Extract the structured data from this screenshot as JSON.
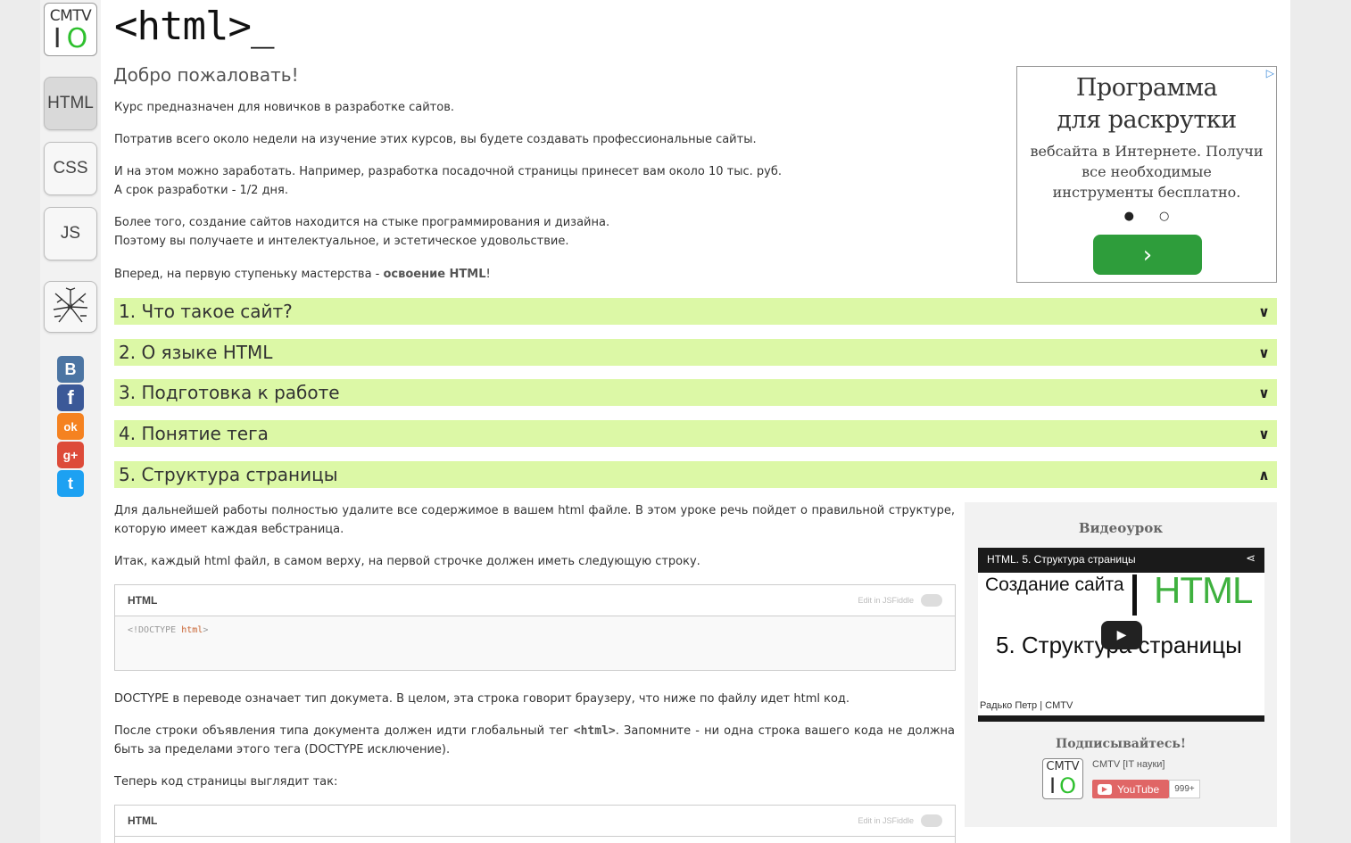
{
  "sidebar": {
    "logo": {
      "line1": "CMTV",
      "line2_bar": "I",
      "line2_o": "O"
    },
    "nav": [
      {
        "label": "HTML",
        "active": true
      },
      {
        "label": "CSS",
        "active": false
      },
      {
        "label": "JS",
        "active": false
      }
    ],
    "tree_icon": "network-tree-icon",
    "social": [
      {
        "name": "vk",
        "glyph": "B",
        "color": "#4c75a3"
      },
      {
        "name": "facebook",
        "glyph": "f",
        "color": "#3b5998"
      },
      {
        "name": "odnoklassniki",
        "glyph": "ok",
        "color": "#f58220"
      },
      {
        "name": "google-plus",
        "glyph": "g+",
        "color": "#dd4b39"
      },
      {
        "name": "twitter",
        "glyph": "t",
        "color": "#1da1f2"
      }
    ]
  },
  "header": {
    "title": "<html>_"
  },
  "welcome": {
    "title": "Добро пожаловать!",
    "p1": "Курс предназначен для новичков в разработке сайтов.",
    "p2": "Потратив всего около недели на изучение этих курсов, вы будете создавать профессиональные сайты.",
    "p3a": "И на этом можно заработать. Например, разработка посадочной страницы принесет вам около 10 тыс. руб.",
    "p3b": "А срок разработки - 1/2 дня.",
    "p4a": "Более того, создание сайтов находится на стыке программирования и дизайна.",
    "p4b": "Поэтому вы получаете и интелектуальное, и эстетическое удовольствие.",
    "p5_text": "Вперед, на первую ступеньку мастерства - ",
    "p5_bold": "освоение HTML",
    "p5_end": "!"
  },
  "ad": {
    "title": "Программа для раскрутки",
    "text": "вебсайта в Интернете. Получи все необходимые инструменты бесплатно.",
    "dots": "● ○",
    "button": "›",
    "corner": "▷"
  },
  "accordion": [
    {
      "label": "1. Что такое сайт?",
      "chevron": "∨"
    },
    {
      "label": "2. О языке HTML",
      "chevron": "∨"
    },
    {
      "label": "3. Подготовка к работе",
      "chevron": "∨"
    },
    {
      "label": "4. Понятие тега",
      "chevron": "∨"
    },
    {
      "label": "5. Структура страницы",
      "chevron": "∧"
    }
  ],
  "lesson": {
    "p1": "Для дальнейшей работы полностью удалите все содержимое в вашем html файле. В этом уроке речь пойдет о правильной структуре, которую имеет каждая вебстраница.",
    "p2": "Итак, каждый html файл, в самом верху, на первой строчке должен иметь следующую строку.",
    "code1": {
      "lang": "HTML",
      "edit": "Edit in JSFiddle",
      "line_a": "<!DOCTYPE ",
      "line_b": "html",
      "line_c": ">"
    },
    "p3": "DOCTYPE в переводе означает тип докумета. В целом, эта строка говорит браузеру, что ниже по файлу идет html код.",
    "p4a": "После строки объявления типа документа должен идти глобальный тег ",
    "p4_tag": "<html>",
    "p4b": ". Запомните - ни одна строка вашего кода не должна быть за пределами этого тега (DOCTYPE исключение).",
    "p5": "Теперь код страницы выглядит так:",
    "code2": {
      "lang": "HTML",
      "edit": "Edit in JSFiddle"
    }
  },
  "video": {
    "panel_title": "Видеоурок",
    "top_title": "HTML. 5. Структура страницы",
    "share": "⋖",
    "line_a": "Создание сайта",
    "line_b": "HTML",
    "line_c": "5. Структура страницы",
    "play": "▶",
    "author": "Радько Петр | CMTV"
  },
  "subscribe": {
    "title": "Подписывайтесь!",
    "logo": {
      "line1": "CMTV",
      "line2_bar": "I",
      "line2_o": "O"
    },
    "channel": "CMTV [IT науки]",
    "youtube_label": "YouTube",
    "youtube_icon": "▶",
    "count": "999+"
  }
}
